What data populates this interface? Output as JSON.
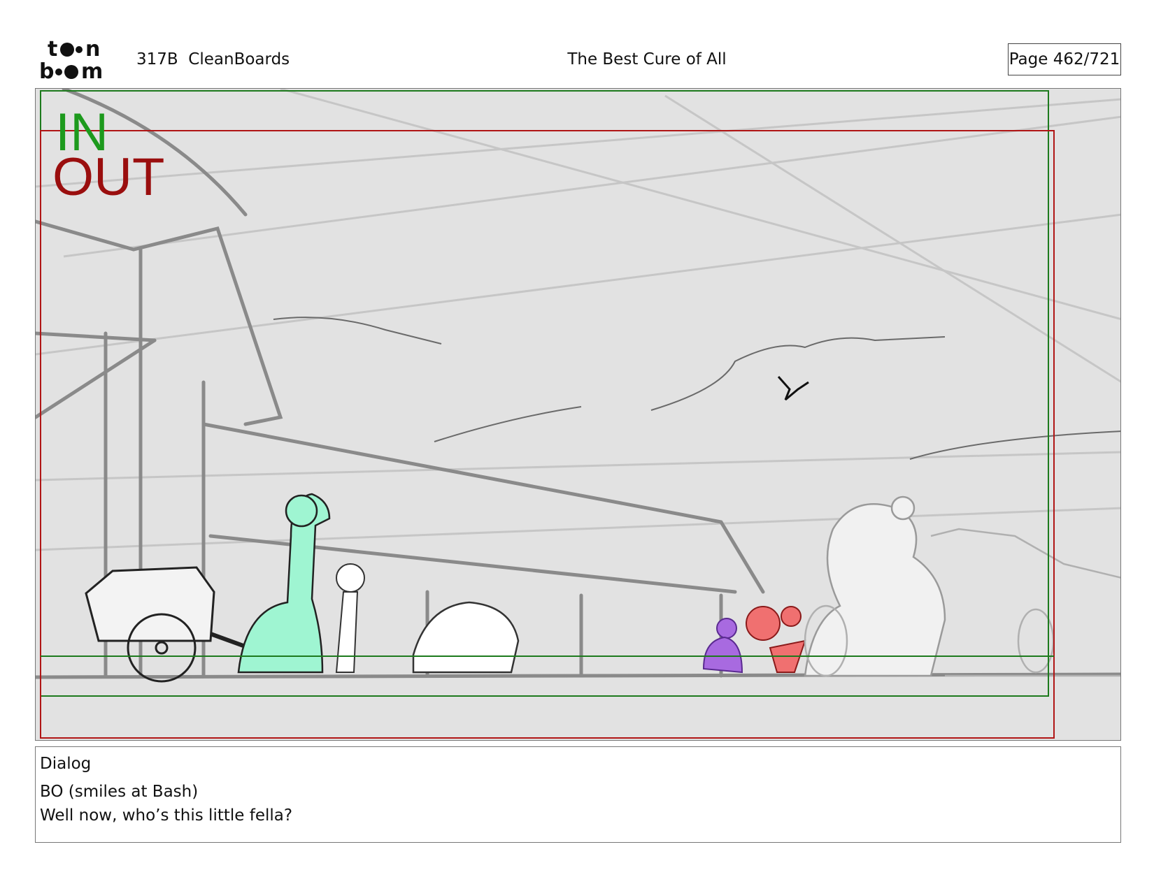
{
  "header": {
    "logo_text": "toon boom",
    "scene_label": "317B  CleanBoards",
    "title": "The Best Cure of All",
    "page_indicator": "Page 462/721"
  },
  "panel": {
    "in_label": "IN",
    "out_label": "OUT",
    "in_frame_color": "#1d7a1d",
    "out_frame_color": "#b01515"
  },
  "dialog": {
    "heading": "Dialog",
    "lines": [
      "BO (smiles at Bash)",
      "Well now, who’s this little fella?"
    ]
  },
  "colors": {
    "sky": "#e2e2e2",
    "sketch": "#7a7a7a",
    "character_green": "#9ff5d2",
    "character_purple": "#a86ae0",
    "character_red": "#f07070"
  }
}
